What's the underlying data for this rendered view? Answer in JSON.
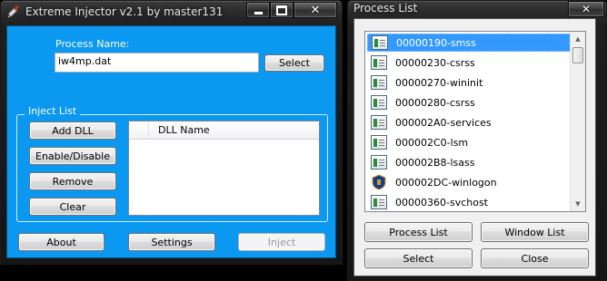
{
  "injector": {
    "title": "Extreme Injector v2.1 by master131",
    "process_name_label": "Process Name:",
    "process_name_value": "iw4mp.dat",
    "select_label": "Select",
    "inject_list_label": "Inject List",
    "buttons": {
      "add_dll": "Add DLL",
      "enable_disable": "Enable/Disable",
      "remove": "Remove",
      "clear": "Clear",
      "about": "About",
      "settings": "Settings",
      "inject": "Inject"
    },
    "dll_column_header": "DLL Name",
    "accent": "#0a98f1"
  },
  "process_list": {
    "title": "Process List",
    "items": [
      {
        "label": "00000190-smss",
        "selected": true,
        "icon": "process-icon"
      },
      {
        "label": "00000230-csrss",
        "selected": false,
        "icon": "process-icon"
      },
      {
        "label": "00000270-wininit",
        "selected": false,
        "icon": "process-icon"
      },
      {
        "label": "00000280-csrss",
        "selected": false,
        "icon": "process-icon"
      },
      {
        "label": "000002A0-services",
        "selected": false,
        "icon": "process-icon"
      },
      {
        "label": "000002C0-lsm",
        "selected": false,
        "icon": "process-icon"
      },
      {
        "label": "000002B8-lsass",
        "selected": false,
        "icon": "process-icon"
      },
      {
        "label": "000002DC-winlogon",
        "selected": false,
        "icon": "shield-icon"
      },
      {
        "label": "00000360-svchost",
        "selected": false,
        "icon": "process-icon"
      }
    ],
    "buttons": {
      "process_list": "Process List",
      "window_list": "Window List",
      "select": "Select",
      "close": "Close"
    }
  }
}
